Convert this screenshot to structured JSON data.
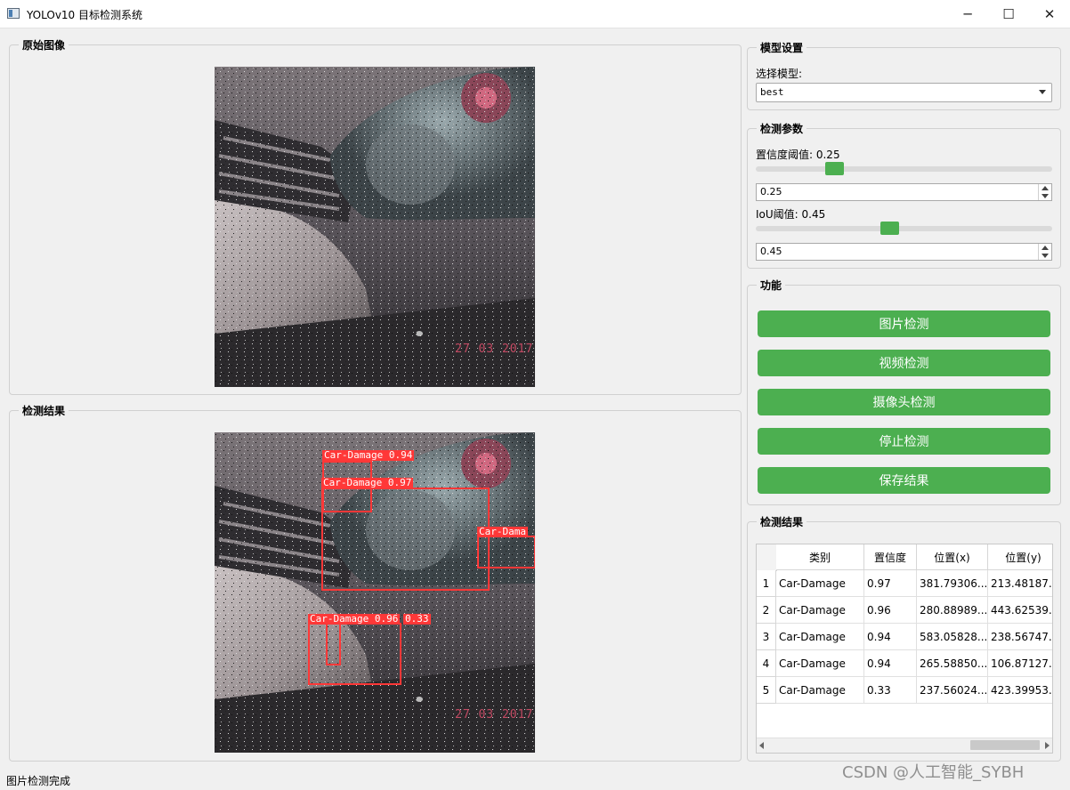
{
  "window": {
    "title": "YOLOv10 目标检测系统",
    "controls": {
      "minimize": "─",
      "maximize": "☐",
      "close": "✕"
    }
  },
  "original_panel": {
    "title": "原始图像",
    "image_stamp": "27 03 2017"
  },
  "result_panel": {
    "title": "检测结果",
    "image_stamp": "27 03 2017",
    "boxes": [
      {
        "label": "Car-Damage 0.94"
      },
      {
        "label": "Car-Damage 0.97"
      },
      {
        "label": "Car-Dama"
      },
      {
        "label": "Car-Damage 0.96"
      },
      {
        "label": "0.33"
      }
    ]
  },
  "model_settings": {
    "title": "模型设置",
    "select_label": "选择模型:",
    "selected_model": "best"
  },
  "detect_params": {
    "title": "检测参数",
    "confidence_label": "置信度阈值: 0.25",
    "confidence_value": "0.25",
    "confidence_level": 0.25,
    "iou_label": "IoU阈值: 0.45",
    "iou_value": "0.45",
    "iou_level": 0.45
  },
  "functions": {
    "title": "功能",
    "image_detect": "图片检测",
    "video_detect": "视频检测",
    "camera_detect": "摄像头检测",
    "stop_detect": "停止检测",
    "save_results": "保存结果"
  },
  "results_table": {
    "title": "检测结果",
    "columns": [
      "类别",
      "置信度",
      "位置(x)",
      "位置(y)"
    ],
    "rows": [
      {
        "num": "1",
        "cls": "Car-Damage",
        "conf": "0.97",
        "x": "381.79306...",
        "y": "213.48187..."
      },
      {
        "num": "2",
        "cls": "Car-Damage",
        "conf": "0.96",
        "x": "280.88989...",
        "y": "443.62539..."
      },
      {
        "num": "3",
        "cls": "Car-Damage",
        "conf": "0.94",
        "x": "583.05828...",
        "y": "238.56747..."
      },
      {
        "num": "4",
        "cls": "Car-Damage",
        "conf": "0.94",
        "x": "265.58850...",
        "y": "106.87127..."
      },
      {
        "num": "5",
        "cls": "Car-Damage",
        "conf": "0.33",
        "x": "237.56024...",
        "y": "423.39953..."
      }
    ]
  },
  "status_bar": {
    "text": "图片检测完成"
  },
  "watermark": "CSDN @人工智能_SYBH",
  "colors": {
    "accent": "#4caf50",
    "box": "#ff3838"
  }
}
